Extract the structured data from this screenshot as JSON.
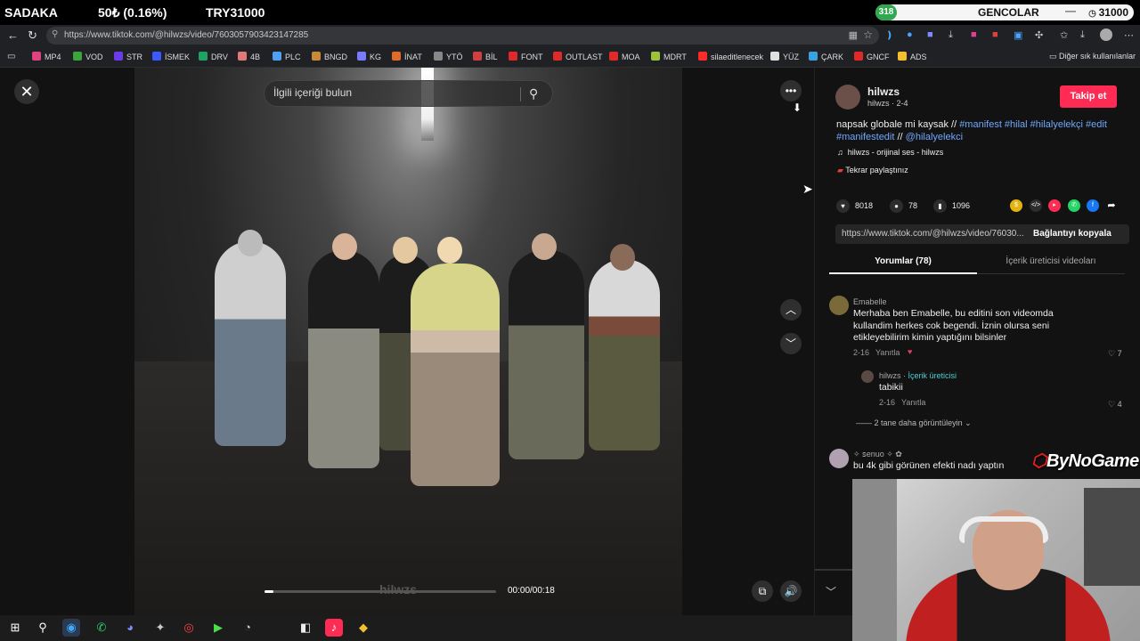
{
  "overlay": {
    "left_title": "SADAKA",
    "middle_value": "50₺ (0.16%)",
    "right_value": "TRY31000",
    "badge_count": "318",
    "username": "GENCOLAR",
    "dash": "—",
    "coins": "31000",
    "colors": {
      "badge": "#2fa84f",
      "pill": "#f5f5f5"
    }
  },
  "browser": {
    "url": "https://www.tiktok.com/@hilwzs/video/7603057903423147285",
    "bookmarks": [
      {
        "label": "MP4",
        "color": "#e0427f"
      },
      {
        "label": "VOD",
        "color": "#3ba53b"
      },
      {
        "label": "STR",
        "color": "#6a3de8"
      },
      {
        "label": "İSMEK",
        "color": "#3d5afe"
      },
      {
        "label": "DRV",
        "color": "#1ea362"
      },
      {
        "label": "4B",
        "color": "#e07a7a"
      },
      {
        "label": "PLC",
        "color": "#4fa0f5"
      },
      {
        "label": "BNGD",
        "color": "#c78a3a"
      },
      {
        "label": "KG",
        "color": "#7a7aff"
      },
      {
        "label": "İNAT",
        "color": "#e06a2a"
      },
      {
        "label": "YTÖ",
        "color": "#888888"
      },
      {
        "label": "BİL",
        "color": "#d04040"
      },
      {
        "label": "FONT",
        "color": "#e02a2a"
      },
      {
        "label": "OUTLAST",
        "color": "#e02a2a"
      },
      {
        "label": "MOA",
        "color": "#e02a2a"
      },
      {
        "label": "MDRT",
        "color": "#9bc23a"
      },
      {
        "label": "silaeditlenecek",
        "color": "#ff2a2a"
      },
      {
        "label": "YÜZ",
        "color": "#e0e0e0"
      },
      {
        "label": "ÇARK",
        "color": "#3aa0e0"
      },
      {
        "label": "GNCF",
        "color": "#e02a2a"
      },
      {
        "label": "ADS",
        "color": "#f0c030"
      }
    ],
    "other_bookmarks": "Diğer sık kullanılanlar"
  },
  "video": {
    "search_placeholder": "İlgili içeriği bulun",
    "watermark": "hilwzs",
    "time": "00:00/00:18",
    "progress": 0.04
  },
  "panel": {
    "author_display": "hilwzs",
    "author_meta": "hilwzs · 2-4",
    "follow_label": "Takip et",
    "caption_plain_1": "napsak globale mi kaysak // ",
    "caption_tags_1": "#manifest #hilal #hilalyelekçi #edit",
    "caption_tags_2": "#manifestedit",
    "caption_sep": " // ",
    "caption_mention": "@hilalyelekci",
    "sound": "hilwzs - orijinal ses - hilwzs",
    "repost": "Tekrar paylaştınız",
    "likes": "8018",
    "comments": "78",
    "saves": "1096",
    "share_url": "https://www.tiktok.com/@hilwzs/video/76030...",
    "copy_label": "Bağlantıyı kopyala",
    "tab_comments": "Yorumlar (78)",
    "tab_creator": "İçerik üreticisi videoları",
    "comment1": {
      "name": "Emabelle",
      "text": "Merhaba ben Emabelle, bu editini son videomda kullandim herkes cok begendi. İznin olursa seni etikleyebilirim kimin yaptığını bilsinler",
      "date": "2-16",
      "reply": "Yanıtla",
      "likes": "7"
    },
    "reply1": {
      "name": "hilwzs",
      "badge": "· İçerik üreticisi",
      "text": "tabikii",
      "date": "2-16",
      "reply": "Yanıtla",
      "likes": "4"
    },
    "more_replies": "2 tane daha görüntüleyin",
    "comment2": {
      "name": "✧ ꜱenuo ✧ ✿",
      "text": "bu 4k gibi görünen efekti nadı yaptın"
    }
  },
  "logo": {
    "mark": "⬡",
    "text": "ByNoGame"
  }
}
